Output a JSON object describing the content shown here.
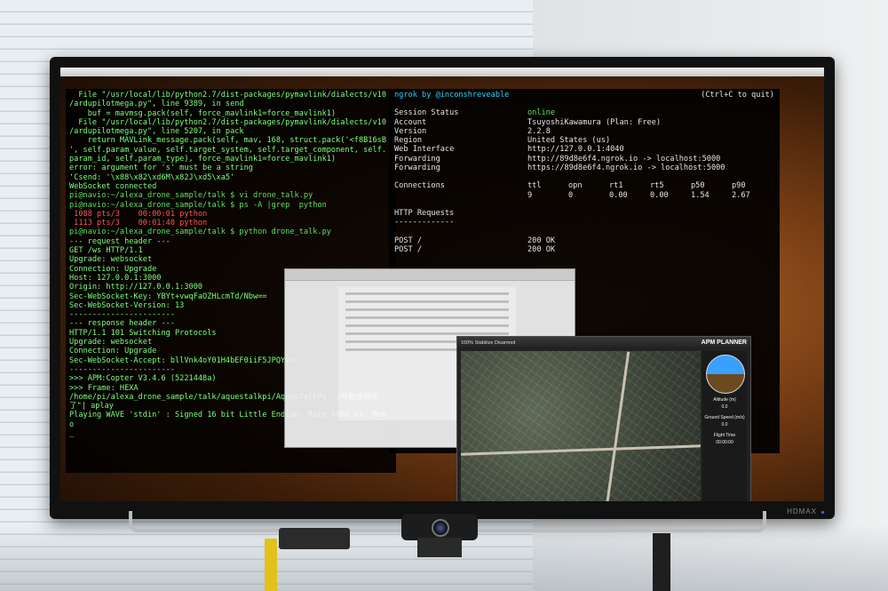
{
  "scene": {
    "brand_label": "HDMAX"
  },
  "terminal": {
    "lines": [
      {
        "text": "  File \"/usr/local/lib/python2.7/dist-packages/pymavlink/dialects/v10",
        "cls": ""
      },
      {
        "text": "/ardupilotmega.py\", line 9389, in send",
        "cls": ""
      },
      {
        "text": "    buf = mavmsg.pack(self, force_mavlink1=force_mavlink1)",
        "cls": ""
      },
      {
        "text": "  File \"/usr/local/lib/python2.7/dist-packages/pymavlink/dialects/v10",
        "cls": ""
      },
      {
        "text": "/ardupilotmega.py\", line 5207, in pack",
        "cls": ""
      },
      {
        "text": "    return MAVLink_message.pack(self, mav, 168, struct.pack('<f8B16sB",
        "cls": ""
      },
      {
        "text": "', self.param_value, self.target_system, self.target_component, self.",
        "cls": ""
      },
      {
        "text": "param_id, self.param_type), force_mavlink1=force_mavlink1)",
        "cls": ""
      },
      {
        "text": "error: argument for 's' must be a string",
        "cls": ""
      },
      {
        "text": "'Csend: '\\x88\\x82\\xd6M\\x82J\\xd5\\xa5'",
        "cls": ""
      },
      {
        "text": "WebSocket connected",
        "cls": ""
      },
      {
        "text": "pi@navio:~/alexa_drone_sample/talk $ vi drone_talk.py",
        "cls": "prompt"
      },
      {
        "text": "pi@navio:~/alexa_drone_sample/talk $ ps -A |grep  python",
        "cls": "prompt"
      },
      {
        "text": " 1088 pts/3    00:00:01 python",
        "cls": "red"
      },
      {
        "text": " 1113 pts/3    00:01:40 python",
        "cls": "red"
      },
      {
        "text": "pi@navio:~/alexa_drone_sample/talk $ python drone_talk.py",
        "cls": "prompt"
      },
      {
        "text": "--- request header ---",
        "cls": ""
      },
      {
        "text": "GET /ws HTTP/1.1",
        "cls": ""
      },
      {
        "text": "Upgrade: websocket",
        "cls": ""
      },
      {
        "text": "Connection: Upgrade",
        "cls": ""
      },
      {
        "text": "Host: 127.0.0.1:3000",
        "cls": ""
      },
      {
        "text": "Origin: http://127.0.0.1:3000",
        "cls": ""
      },
      {
        "text": "Sec-WebSocket-Key: YBYt+vwqFaOZHLcmTd/Nbw==",
        "cls": ""
      },
      {
        "text": "Sec-WebSocket-Version: 13",
        "cls": ""
      },
      {
        "text": "",
        "cls": ""
      },
      {
        "text": "",
        "cls": ""
      },
      {
        "text": "-----------------------",
        "cls": ""
      },
      {
        "text": "--- response header ---",
        "cls": ""
      },
      {
        "text": "HTTP/1.1 101 Switching Protocols",
        "cls": ""
      },
      {
        "text": "Upgrade: websocket",
        "cls": ""
      },
      {
        "text": "Connection: Upgrade",
        "cls": ""
      },
      {
        "text": "Sec-WebSocket-Accept: bllVnk4oY01H4bEF0iiF5JPQYs=",
        "cls": ""
      },
      {
        "text": "-----------------------",
        "cls": ""
      },
      {
        "text": ">>> APM:Copter V3.4.6 (5221448a)",
        "cls": ""
      },
      {
        "text": ">>> Frame: HEXA",
        "cls": ""
      },
      {
        "text": "/home/pi/alexa_drone_sample/talk/aquestalkpi/AquesTalkPi \"1号機接続完",
        "cls": ""
      },
      {
        "text": "了\"| aplay",
        "cls": ""
      },
      {
        "text": "Playing WAVE 'stdin' : Signed 16 bit Little Endian, Rate 8000 Hz, Mon",
        "cls": ""
      },
      {
        "text": "o",
        "cls": ""
      },
      {
        "text": "_",
        "cls": ""
      }
    ]
  },
  "ngrok": {
    "title": "ngrok by @inconshreveable",
    "quit": "(Ctrl+C to quit)",
    "rows": [
      {
        "k": "Session Status",
        "v": "online"
      },
      {
        "k": "Account",
        "v": "TsuyoshiKawamura (Plan: Free)"
      },
      {
        "k": "Version",
        "v": "2.2.8"
      },
      {
        "k": "Region",
        "v": "United States (us)"
      },
      {
        "k": "Web Interface",
        "v": "http://127.0.0.1:4040"
      },
      {
        "k": "Forwarding",
        "v": "http://89d8e6f4.ngrok.io -> localhost:5000"
      },
      {
        "k": "Forwarding",
        "v": "https://89d8e6f4.ngrok.io -> localhost:5000"
      }
    ],
    "connections_label": "Connections",
    "stat_headers": [
      "ttl",
      "opn",
      "rt1",
      "rt5",
      "p50",
      "p90"
    ],
    "stat_values": [
      "9",
      "0",
      "0.00",
      "0.00",
      "1.54",
      "2.67"
    ],
    "http_title": "HTTP Requests",
    "http_rule": "-------------",
    "requests": [
      {
        "method": "POST /",
        "status": "200 OK"
      },
      {
        "method": "POST /",
        "status": "200 OK"
      }
    ]
  },
  "mapwin": {
    "toolbar_text": "100%  Stabilize  Disarmed",
    "logo": "APM PLANNER",
    "readouts": [
      "Altitude (m)",
      "0.0",
      "Ground Speed (m/s)",
      "0.0",
      "Flight Time",
      "00:00:00"
    ]
  }
}
